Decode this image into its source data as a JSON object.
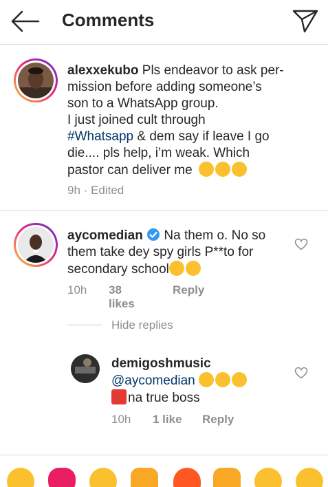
{
  "header": {
    "title": "Comments"
  },
  "caption": {
    "username": "alexxekubo",
    "line1": "Pls endeavor to ask per-",
    "line2": "mission before adding someone’s",
    "line3": "son to a WhatsApp group.",
    "line4": "I just joined cult through",
    "hashtag": "#Whatsapp",
    "line5_rest": " & dem say if leave I go",
    "line6": "die.... pls help, i’m weak. Which",
    "line7": "pastor can deliver me",
    "time": "9h",
    "edited": "· Edited"
  },
  "comment1": {
    "username": "aycomedian",
    "line1": "Na them o. No so",
    "line2": "them take dey spy girls P**to for",
    "line3": "secondary school",
    "time": "10h",
    "likes": "38 likes",
    "reply": "Reply"
  },
  "hide_replies": "Hide replies",
  "reply1": {
    "username": "demigoshmusic",
    "mention": "@aycomedian",
    "line2": "na true boss",
    "time": "10h",
    "likes": "1 like",
    "reply": "Reply"
  },
  "colors": {
    "link": "#003569",
    "muted": "#8e8e8e",
    "verified": "#3897f0"
  },
  "icons": [
    "back-arrow-icon",
    "direct-send-icon",
    "verified-badge-icon",
    "heart-outline-icon"
  ],
  "emoji_bar": [
    "laughing-emoji",
    "red-heart-emoji",
    "surprised-emoji",
    "raised-hands-emoji",
    "fire-emoji",
    "clapping-hands-emoji",
    "crying-emoji",
    "heart-eyes-emoji"
  ]
}
